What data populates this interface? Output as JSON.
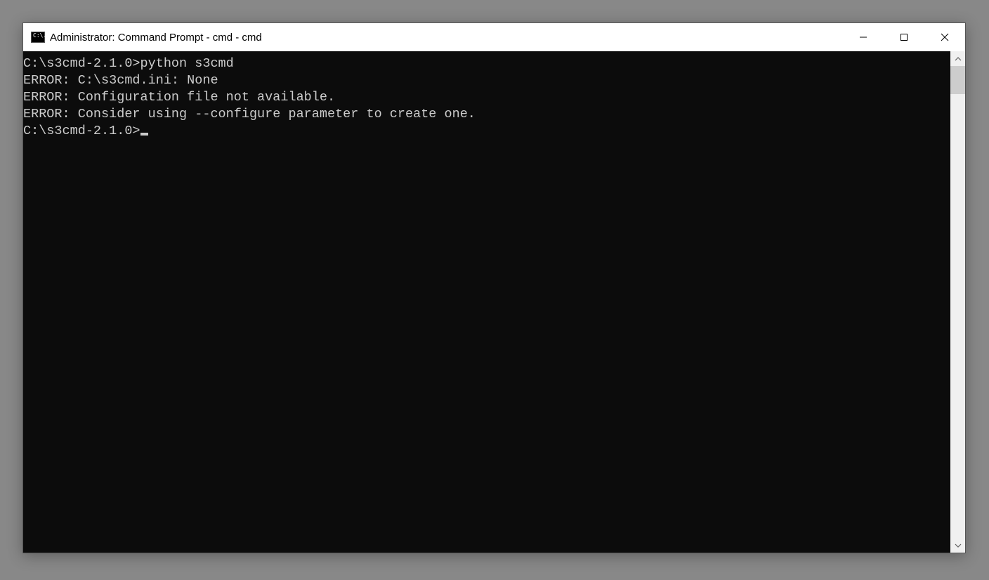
{
  "titlebar": {
    "icon_label": "C:\\.",
    "title": "Administrator: Command Prompt - cmd - cmd"
  },
  "terminal": {
    "lines": [
      "",
      "C:\\s3cmd-2.1.0>python s3cmd",
      "ERROR: C:\\s3cmd.ini: None",
      "ERROR: Configuration file not available.",
      "ERROR: Consider using --configure parameter to create one.",
      "",
      "C:\\s3cmd-2.1.0>"
    ],
    "cursor_on_last_line": true
  }
}
